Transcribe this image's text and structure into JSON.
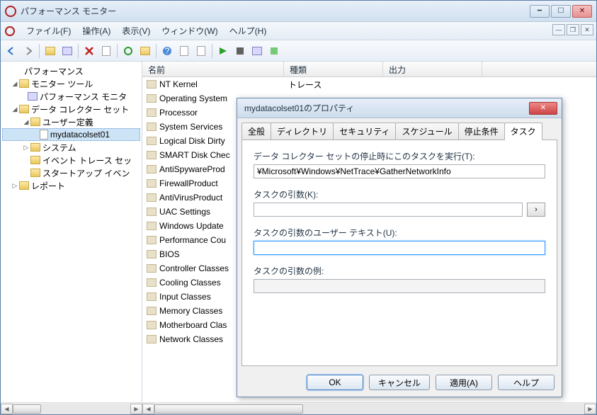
{
  "window": {
    "title": "パフォーマンス モニター"
  },
  "menu": {
    "file": "ファイル(F)",
    "action": "操作(A)",
    "view": "表示(V)",
    "window": "ウィンドウ(W)",
    "help": "ヘルプ(H)"
  },
  "tree": {
    "root": "パフォーマンス",
    "monitor_tools": "モニター ツール",
    "perf_monitor": "パフォーマンス モニタ",
    "dcs": "データ コレクター セット",
    "user_defined": "ユーザー定義",
    "mydatacolset": "mydatacolset01",
    "system": "システム",
    "event_trace": "イベント トレース セッ",
    "startup_event": "スタートアップ イベン",
    "reports": "レポート"
  },
  "list": {
    "headers": {
      "name": "名前",
      "type": "種類",
      "output": "出力"
    },
    "rows": [
      {
        "name": "NT Kernel",
        "type": "トレース"
      },
      {
        "name": "Operating System",
        "type": ""
      },
      {
        "name": "Processor",
        "type": ""
      },
      {
        "name": "System Services",
        "type": ""
      },
      {
        "name": "Logical Disk Dirty",
        "type": ""
      },
      {
        "name": "SMART Disk Chec",
        "type": ""
      },
      {
        "name": "AntiSpywareProd",
        "type": ""
      },
      {
        "name": "FirewallProduct",
        "type": ""
      },
      {
        "name": "AntiVirusProduct",
        "type": ""
      },
      {
        "name": "UAC Settings",
        "type": ""
      },
      {
        "name": "Windows Update",
        "type": ""
      },
      {
        "name": "Performance Cou",
        "type": ""
      },
      {
        "name": "BIOS",
        "type": ""
      },
      {
        "name": "Controller Classes",
        "type": ""
      },
      {
        "name": "Cooling Classes",
        "type": ""
      },
      {
        "name": "Input Classes",
        "type": ""
      },
      {
        "name": "Memory Classes",
        "type": ""
      },
      {
        "name": "Motherboard Clas",
        "type": ""
      },
      {
        "name": "Network Classes",
        "type": ""
      }
    ]
  },
  "dialog": {
    "title": "mydatacolset01のプロパティ",
    "tabs": {
      "general": "全般",
      "directory": "ディレクトリ",
      "security": "セキュリティ",
      "schedule": "スケジュール",
      "stop": "停止条件",
      "task": "タスク"
    },
    "task_run_label": "データ コレクター セットの停止時にこのタスクを実行(T):",
    "task_run_value": "¥Microsoft¥Windows¥NetTrace¥GatherNetworkInfo",
    "task_args_label": "タスクの引数(K):",
    "task_args_value": "",
    "task_user_text_label": "タスクの引数のユーザー テキスト(U):",
    "task_user_text_value": "",
    "task_args_example_label": "タスクの引数の例:",
    "task_args_example_value": "",
    "buttons": {
      "ok": "OK",
      "cancel": "キャンセル",
      "apply": "適用(A)",
      "help": "ヘルプ"
    }
  }
}
